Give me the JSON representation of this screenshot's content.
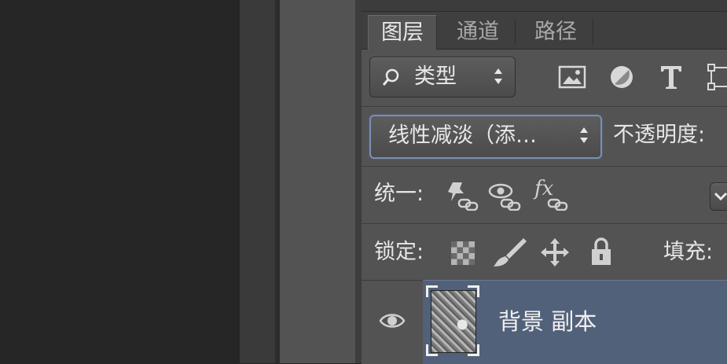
{
  "layers_panel": {
    "tabs": [
      {
        "label": "图层",
        "active": true
      },
      {
        "label": "通道",
        "active": false
      },
      {
        "label": "路径",
        "active": false
      }
    ],
    "filter": {
      "kind_label": "类型",
      "filter_icons": [
        "image-filter-icon",
        "adjustment-filter-icon",
        "type-filter-icon",
        "shape-filter-icon"
      ]
    },
    "blend": {
      "mode_label": "线性减淡（添…",
      "opacity_label": "不透明度:"
    },
    "unify": {
      "label": "统一:",
      "icons": [
        "unify-position-icon",
        "unify-visibility-icon",
        "unify-style-icon"
      ]
    },
    "lock": {
      "label": "锁定:",
      "icons": [
        "lock-transparent-pixels-icon",
        "lock-image-pixels-icon",
        "lock-position-icon",
        "lock-all-icon"
      ],
      "fill_label": "填充:"
    },
    "layers": [
      {
        "name": "背景 副本",
        "visible": true,
        "selected": true
      }
    ]
  },
  "colors": {
    "panel_bg": "#535353",
    "selected_layer": "#52617a",
    "text": "#e6e6e6"
  }
}
